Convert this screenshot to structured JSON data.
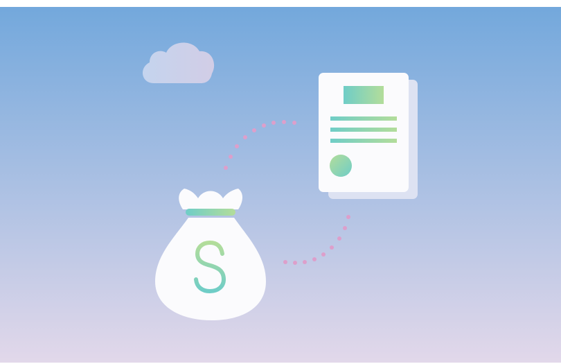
{
  "scene": {
    "description_icons": [
      "cloud-icon",
      "money-bag-icon",
      "dollar-sign-icon",
      "document-icon"
    ],
    "colors": {
      "sky_top": "#73a8dc",
      "sky_bottom": "#e2d8ea",
      "cloud_left": "#c4d4ee",
      "cloud_right": "#d2cde6",
      "paper": "#fbfbfd",
      "paper_shadow": "#dde2f2",
      "accent_teal": "#6fcdc7",
      "accent_green": "#b3dd9a",
      "dots": "#dd9fcb"
    }
  }
}
